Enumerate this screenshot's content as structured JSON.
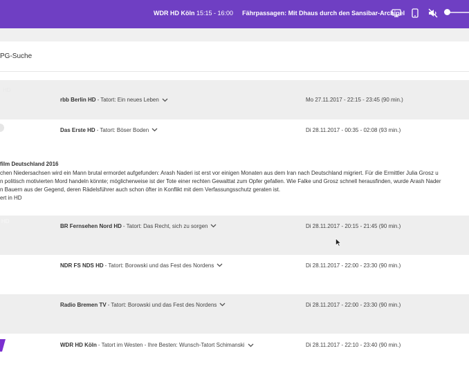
{
  "header": {
    "channel": "WDR HD Köln",
    "time": "15:15 - 16:00",
    "program": "Fährpassagen: Mit Dhaus durch den Sansibar-Archipel",
    "icons": [
      "tv-icon",
      "phone-icon",
      "mute-icon",
      "volume-slider"
    ],
    "volume": 0.0
  },
  "page": {
    "title": "PG-Suche"
  },
  "rows": [
    {
      "logo_text": "HD",
      "channel": "rbb Berlin HD",
      "title": " - Tatort: Ein neues Leben",
      "time": "Mo 27.11.2017 - 22:15 - 23:45 (90 min.)"
    },
    {
      "logo_text": "",
      "channel": "Das Erste HD",
      "title": " - Tatort: Böser Boden",
      "time": "Di 28.11.2017 - 00:35 - 02:08 (93 min.)"
    },
    {
      "logo_text": "HD",
      "channel": "BR Fernsehen Nord HD",
      "title": " - Tatort: Das Recht, sich zu sorgen",
      "time": "Di 28.11.2017 - 20:15 - 21:45 (90 min.)"
    },
    {
      "logo_text": "",
      "channel": "NDR FS NDS HD",
      "title": " - Tatort: Borowski und das Fest des Nordens",
      "time": "Di 28.11.2017 - 22:00 - 23:30 (90 min.)"
    },
    {
      "logo_text": "",
      "channel": "Radio Bremen TV",
      "title": " - Tatort: Borowski und das Fest des Nordens",
      "time": "Di 28.11.2017 - 22:00 - 23:30 (90 min.)"
    },
    {
      "logo_text": "",
      "channel": "WDR HD Köln",
      "title": " - Tatort im Westen - Ihre Besten: Wunsch-Tatort Schimanski",
      "time": "Di 28.11.2017 - 22:10 - 23:40 (90 min.)"
    }
  ],
  "detail": {
    "heading": "film Deutschland 2016",
    "line1": "chen Niedersachsen wird ein Mann brutal ermordet aufgefunden: Arash Naderi ist erst vor einigen Monaten aus dem Iran nach Deutschland migriert. Für die Ermittler Julia Grosz u",
    "line2": "n politisch motivierten Mord handeln könnte; möglicherweise ist der Tote einer rechten Gewalttat zum Opfer gefallen. Wie Falke und Grosz schnell herausfinden, wurde Arash Nader",
    "line3": "n Bauern aus der Gegend, deren Rädelsführer auch schon öfter in Konflikt mit dem Verfassungsschutz geraten ist.",
    "line4": "ert in HD"
  },
  "colors": {
    "accent": "#6f3fc3",
    "row_grey": "#eeeeee"
  }
}
